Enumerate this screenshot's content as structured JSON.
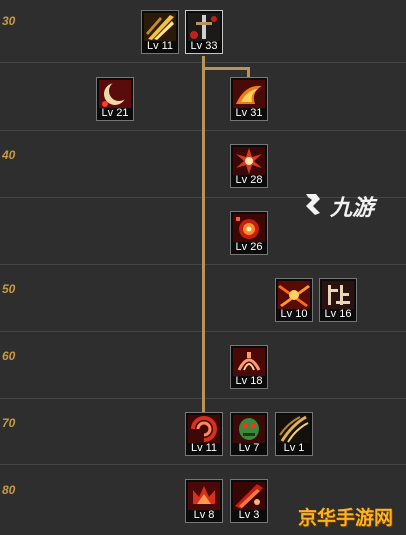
{
  "level_rows": [
    {
      "label": "30"
    },
    {
      "label": ""
    },
    {
      "label": "40"
    },
    {
      "label": ""
    },
    {
      "label": "50"
    },
    {
      "label": "60"
    },
    {
      "label": "70"
    },
    {
      "label": "80"
    }
  ],
  "skills": [
    {
      "id": "s1",
      "level": "Lv 11",
      "icon": "golden-slash-icon"
    },
    {
      "id": "s2",
      "level": "Lv 33",
      "icon": "sword-cross-icon"
    },
    {
      "id": "s3",
      "level": "Lv 21",
      "icon": "crescent-moon-icon"
    },
    {
      "id": "s4",
      "level": "Lv 31",
      "icon": "flame-dash-icon"
    },
    {
      "id": "s5",
      "level": "Lv 28",
      "icon": "burst-icon"
    },
    {
      "id": "s6",
      "level": "Lv 26",
      "icon": "explosion-icon"
    },
    {
      "id": "s7",
      "level": "Lv 10",
      "icon": "fire-cross-icon"
    },
    {
      "id": "s8",
      "level": "Lv 16",
      "icon": "soul-glyph-icon"
    },
    {
      "id": "s9",
      "level": "Lv 18",
      "icon": "demon-mark-icon"
    },
    {
      "id": "s10",
      "level": "Lv 11",
      "icon": "swirl-blade-icon"
    },
    {
      "id": "s11",
      "level": "Lv 7",
      "icon": "green-spirit-icon"
    },
    {
      "id": "s12",
      "level": "Lv 1",
      "icon": "gold-claw-icon"
    },
    {
      "id": "s13",
      "level": "Lv 8",
      "icon": "crown-flame-icon"
    },
    {
      "id": "s14",
      "level": "Lv 3",
      "icon": "red-strike-icon"
    }
  ],
  "watermark_top": {
    "text": "九游",
    "icon": "nine-game-logo-icon"
  },
  "watermark_bottom": {
    "text": "京华手游网"
  },
  "colors": {
    "background": "#2e2e2e",
    "level_label": "#c69a43",
    "connector": "#b8945a",
    "watermark_orange": "#ffb21a"
  }
}
